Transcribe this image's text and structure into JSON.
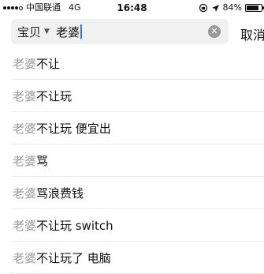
{
  "status_bar": {
    "carrier": "中国联通",
    "network": "4G",
    "time": "16:48",
    "battery_text": "84%",
    "battery_level": 0.84,
    "signal_bars": 4
  },
  "search": {
    "scope_label": "宝贝",
    "query": "老婆",
    "cancel_label": "取消"
  },
  "suggestions": [
    {
      "match": "老婆",
      "rest": "不让"
    },
    {
      "match": "老婆",
      "rest": "不让玩"
    },
    {
      "match": "老婆",
      "rest": "不让玩 便宜出"
    },
    {
      "match": "老婆",
      "rest": "骂"
    },
    {
      "match": "老婆",
      "rest": "骂浪费钱"
    },
    {
      "match": "老婆",
      "rest": "不让玩 switch"
    },
    {
      "match": "老婆",
      "rest": "不让玩了 电脑"
    }
  ],
  "icons": {
    "clear": "clear-icon",
    "lock": "orientation-lock-icon",
    "location": "location-arrow-icon",
    "battery": "battery-icon"
  }
}
